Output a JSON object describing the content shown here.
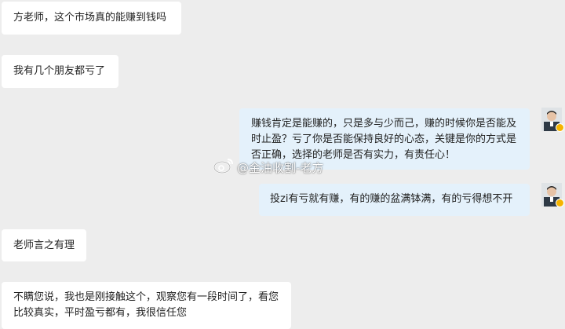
{
  "messages": [
    {
      "side": "left",
      "text": "方老师，这个市场真的能赚到钱吗"
    },
    {
      "side": "left",
      "text": "我有几个朋友都亏了"
    },
    {
      "side": "right",
      "text": "赚钱肯定是能赚的，只是多与少而己，赚的时候你是否能及时止盈？亏了你是否能保持良好的心态，关键是你的方式是否正确，选择的老师是否有实力，有责任心！"
    },
    {
      "side": "right",
      "text": "投zi有亏就有赚，有的赚的盆满钵满，有的亏得想不开"
    },
    {
      "side": "left",
      "text": "老师言之有理"
    },
    {
      "side": "left",
      "text": "不瞒您说，我也是刚接触这个，观察您有一段时间了，看您比较真实，平时盈亏都有，我很信任您"
    }
  ],
  "watermark": {
    "text": "@金油收割-老方",
    "icon": "weibo-icon"
  },
  "avatar": {
    "icon": "user-avatar-icon",
    "badge_color": "#f5b400"
  },
  "colors": {
    "background": "#ededed",
    "left_bubble": "#ffffff",
    "right_bubble": "#e4f1fb"
  }
}
